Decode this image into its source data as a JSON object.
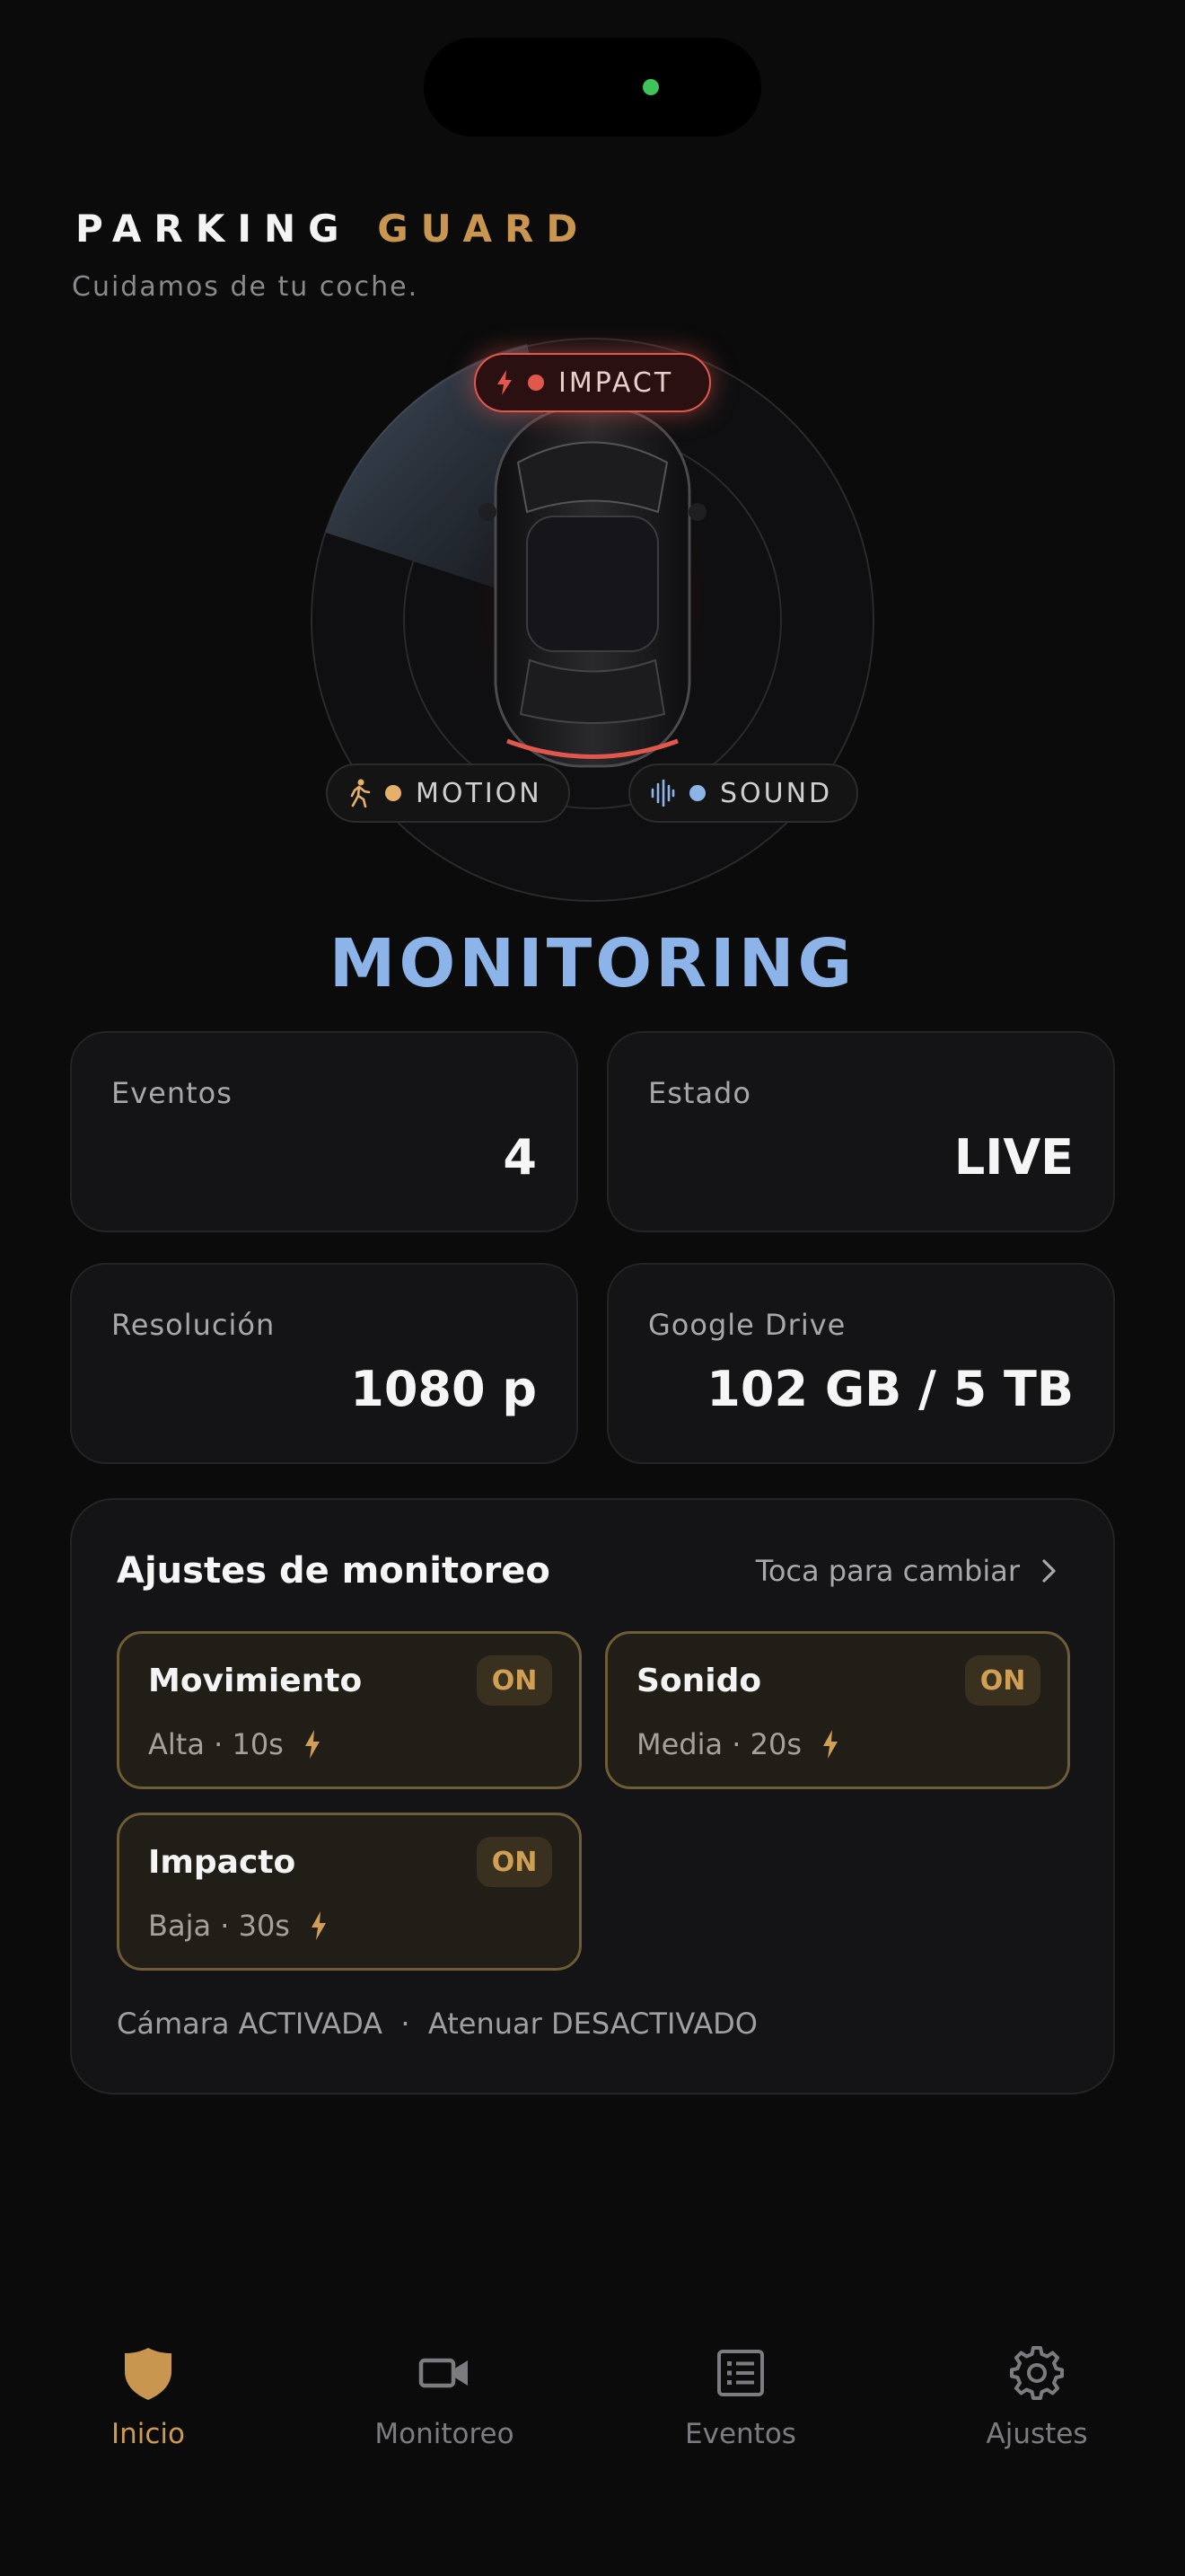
{
  "app": {
    "brand_word1": "PARKING",
    "brand_word2": "GUARD",
    "tagline": "Cuidamos de tu coche."
  },
  "indicators": {
    "impact": {
      "label": "IMPACT",
      "icon": "bolt-icon",
      "dot_color": "#e2574c"
    },
    "motion": {
      "label": "MOTION",
      "icon": "running-person-icon",
      "dot_color": "#e6b06a"
    },
    "sound": {
      "label": "SOUND",
      "icon": "sound-wave-icon",
      "dot_color": "#8db4e8"
    }
  },
  "status": {
    "title": "MONITORING",
    "color": "#8db4e8"
  },
  "stats": [
    {
      "label": "Eventos",
      "value": "4"
    },
    {
      "label": "Estado",
      "value": "LIVE"
    },
    {
      "label": "Resolución",
      "value": "1080 p"
    },
    {
      "label": "Google Drive",
      "value": "102 GB / 5 TB"
    }
  ],
  "monitoring_settings": {
    "title": "Ajustes de monitoreo",
    "link": "Toca para cambiar",
    "items": [
      {
        "name": "Movimiento",
        "badge": "ON",
        "detail": "Alta · 10s"
      },
      {
        "name": "Sonido",
        "badge": "ON",
        "detail": "Media · 20s"
      },
      {
        "name": "Impacto",
        "badge": "ON",
        "detail": "Baja · 30s"
      }
    ],
    "footer": "Cámara ACTIVADA  ·  Atenuar DESACTIVADO"
  },
  "tabs": [
    {
      "label": "Inicio",
      "icon": "shield-icon",
      "active": true
    },
    {
      "label": "Monitoreo",
      "icon": "video-camera-icon",
      "active": false
    },
    {
      "label": "Eventos",
      "icon": "list-icon",
      "active": false
    },
    {
      "label": "Ajustes",
      "icon": "gear-icon",
      "active": false
    }
  ],
  "colors": {
    "accent": "#c8964f",
    "alert": "#e2574c",
    "background": "#0b0b0c"
  }
}
